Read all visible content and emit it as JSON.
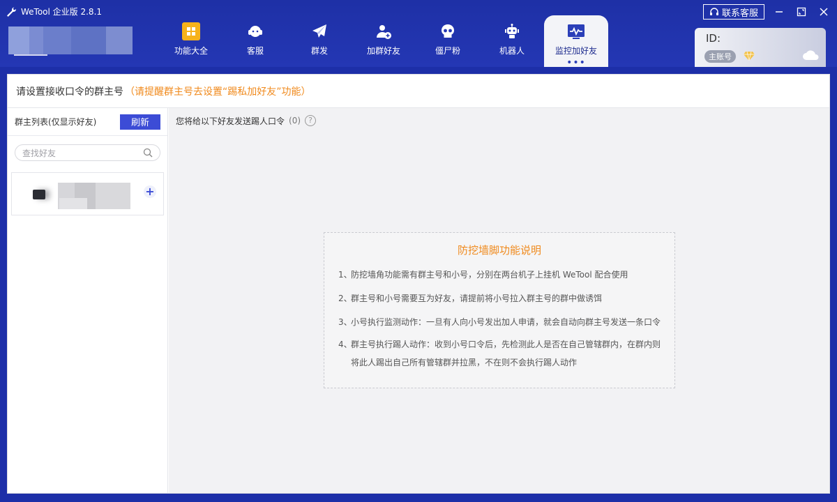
{
  "app": {
    "title": "WeTool 企业版 2.8.1"
  },
  "nav": [
    {
      "label": "功能大全",
      "icon": "grid-icon"
    },
    {
      "label": "客服",
      "icon": "headset-icon"
    },
    {
      "label": "群发",
      "icon": "paper-plane-icon"
    },
    {
      "label": "加群好友",
      "icon": "add-user-icon"
    },
    {
      "label": "僵尸粉",
      "icon": "skull-icon"
    },
    {
      "label": "机器人",
      "icon": "robot-icon"
    },
    {
      "label": "监控加好友",
      "icon": "monitor-pulse-icon",
      "active": true
    }
  ],
  "window": {
    "contact_label": "联系客服"
  },
  "account": {
    "id_label": "ID:",
    "tag": "主账号"
  },
  "header": {
    "title": "请设置接收口令的群主号",
    "hint": "（请提醒群主号去设置“踢私加好友”功能）"
  },
  "left": {
    "list_title": "群主列表(仅显示好友)",
    "refresh_label": "刷新",
    "search_placeholder": "查找好友"
  },
  "right": {
    "title": "您将给以下好友发送踢人口令",
    "count": "(0)"
  },
  "info": {
    "title": "防挖墙脚功能说明",
    "items": [
      {
        "num": "1、",
        "text": "防挖墙角功能需有群主号和小号，分别在两台机子上挂机 WeTool 配合使用"
      },
      {
        "num": "2、",
        "text": "群主号和小号需要互为好友，请提前将小号拉入群主号的群中做诱饵"
      },
      {
        "num": "3、",
        "text": "小号执行监测动作：一旦有人向小号发出加人申请，就会自动向群主号发送一条口令"
      },
      {
        "num": "4、",
        "text": "群主号执行踢人动作：收到小号口令后，先检测此人是否在自己管辖群内，在群内则将此人踢出自己所有管辖群并拉黑，不在则不会执行踢人动作"
      }
    ]
  },
  "colors": {
    "brand": "#1e30a6",
    "accent": "#3c4cd6",
    "hint": "#f08a1d"
  }
}
